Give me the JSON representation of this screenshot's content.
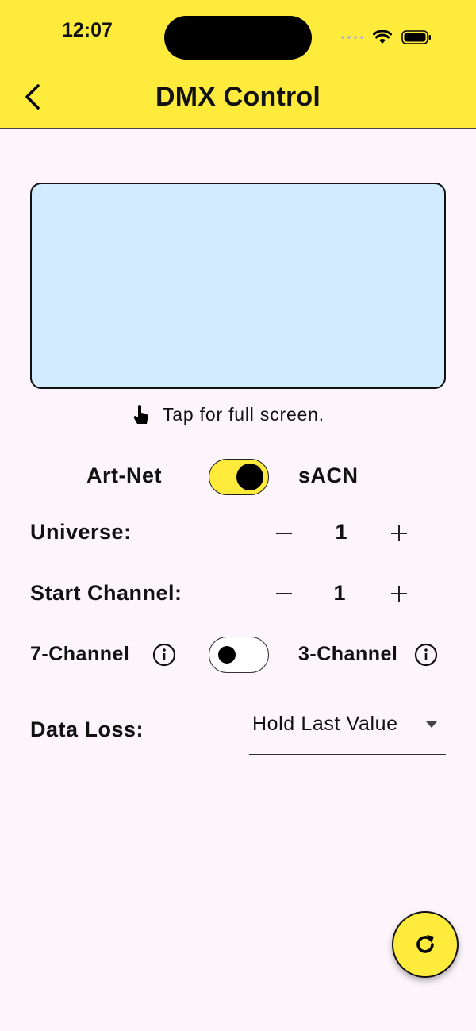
{
  "status_bar": {
    "time": "12:07"
  },
  "app_bar": {
    "title": "DMX Control"
  },
  "preview": {
    "hint": "Tap for full screen."
  },
  "protocol": {
    "left_label": "Art-Net",
    "right_label": "sACN",
    "selected": "sACN"
  },
  "universe": {
    "label": "Universe:",
    "value": "1"
  },
  "start_channel": {
    "label": "Start Channel:",
    "value": "1"
  },
  "channel_mode": {
    "left_label": "7-Channel",
    "right_label": "3-Channel",
    "selected": "7-Channel"
  },
  "data_loss": {
    "label": "Data Loss:",
    "selected": "Hold Last Value"
  },
  "colors": {
    "accent": "#ffeb3b",
    "preview_fill": "#d2ebfe",
    "background": "#fcf5fb"
  }
}
